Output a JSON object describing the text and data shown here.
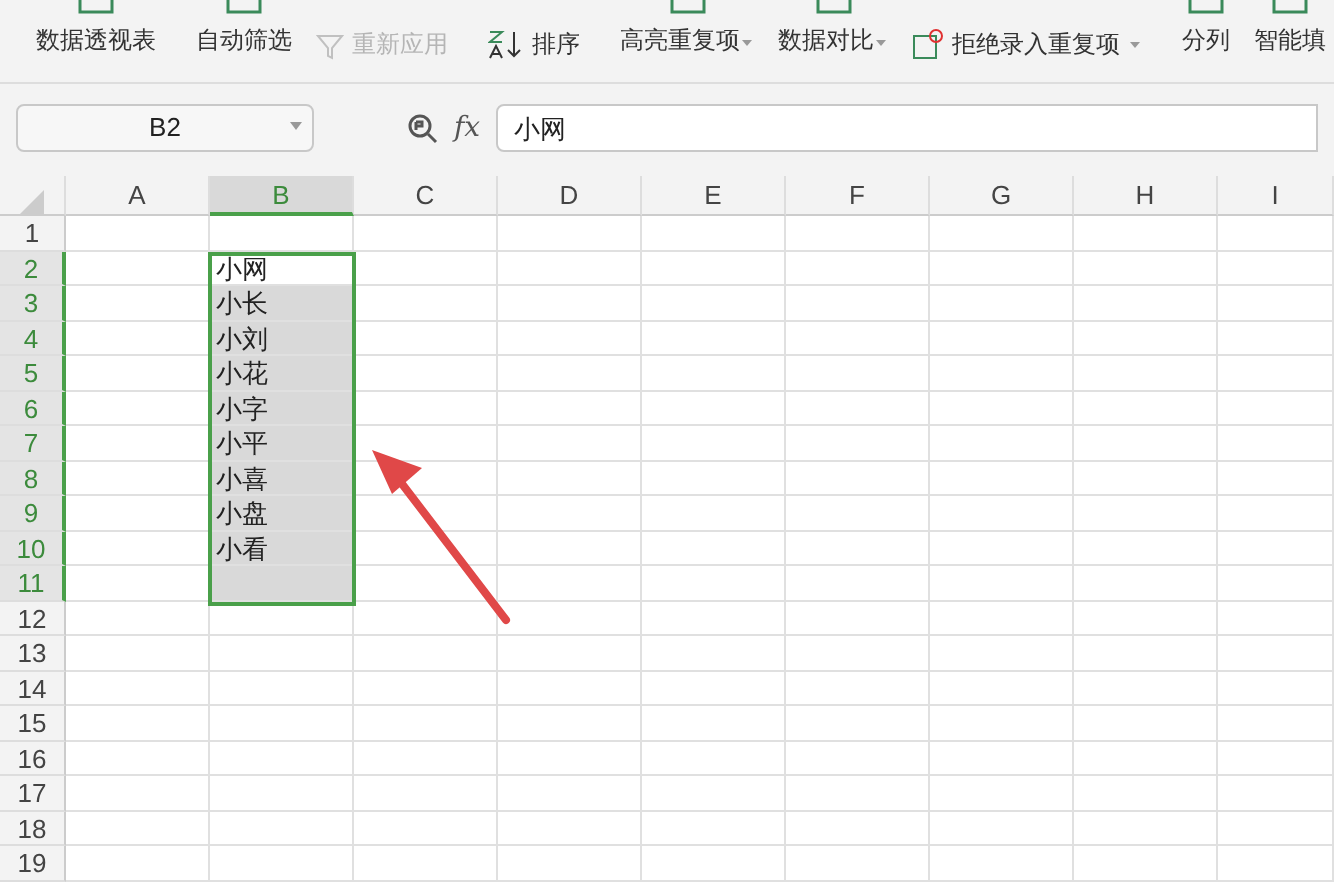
{
  "ribbon": {
    "items": [
      {
        "label": "数据透视表",
        "kind": "large",
        "disabled": false
      },
      {
        "kind": "divider"
      },
      {
        "label": "自动筛选",
        "kind": "large",
        "disabled": false
      },
      {
        "label": "重新应用",
        "kind": "small",
        "disabled": true
      },
      {
        "kind": "launcher"
      },
      {
        "kind": "divider"
      },
      {
        "label": "排序",
        "kind": "sort",
        "disabled": false
      },
      {
        "kind": "divider"
      },
      {
        "label": "高亮重复项",
        "kind": "dropdown",
        "disabled": false
      },
      {
        "label": "数据对比",
        "kind": "dropdown",
        "disabled": false
      },
      {
        "label": "拒绝录入重复项",
        "kind": "reject",
        "disabled": false
      },
      {
        "kind": "divider"
      },
      {
        "label": "分列",
        "kind": "large",
        "disabled": false
      },
      {
        "label": "智能填",
        "kind": "large",
        "disabled": false
      }
    ]
  },
  "name_box": {
    "value": "B2"
  },
  "formula_bar": {
    "function_label": "fx",
    "value": "小网"
  },
  "columns": [
    {
      "label": "A",
      "selected": false
    },
    {
      "label": "B",
      "selected": true
    },
    {
      "label": "C",
      "selected": false
    },
    {
      "label": "D",
      "selected": false
    },
    {
      "label": "E",
      "selected": false
    },
    {
      "label": "F",
      "selected": false
    },
    {
      "label": "G",
      "selected": false
    },
    {
      "label": "H",
      "selected": false
    },
    {
      "label": "I",
      "selected": false
    }
  ],
  "rows": [
    {
      "label": "1",
      "selected": false
    },
    {
      "label": "2",
      "selected": true,
      "column_b": "小网"
    },
    {
      "label": "3",
      "selected": true,
      "column_b": "小长"
    },
    {
      "label": "4",
      "selected": true,
      "column_b": "小刘"
    },
    {
      "label": "5",
      "selected": true,
      "column_b": "小花"
    },
    {
      "label": "6",
      "selected": true,
      "column_b": "小字"
    },
    {
      "label": "7",
      "selected": true,
      "column_b": "小平"
    },
    {
      "label": "8",
      "selected": true,
      "column_b": "小喜"
    },
    {
      "label": "9",
      "selected": true,
      "column_b": "小盘"
    },
    {
      "label": "10",
      "selected": true,
      "column_b": "小看"
    },
    {
      "label": "11",
      "selected": true
    },
    {
      "label": "12",
      "selected": false
    },
    {
      "label": "13",
      "selected": false
    },
    {
      "label": "14",
      "selected": false
    },
    {
      "label": "15",
      "selected": false
    },
    {
      "label": "16",
      "selected": false
    },
    {
      "label": "17",
      "selected": false
    },
    {
      "label": "18",
      "selected": false
    },
    {
      "label": "19",
      "selected": false
    }
  ]
}
